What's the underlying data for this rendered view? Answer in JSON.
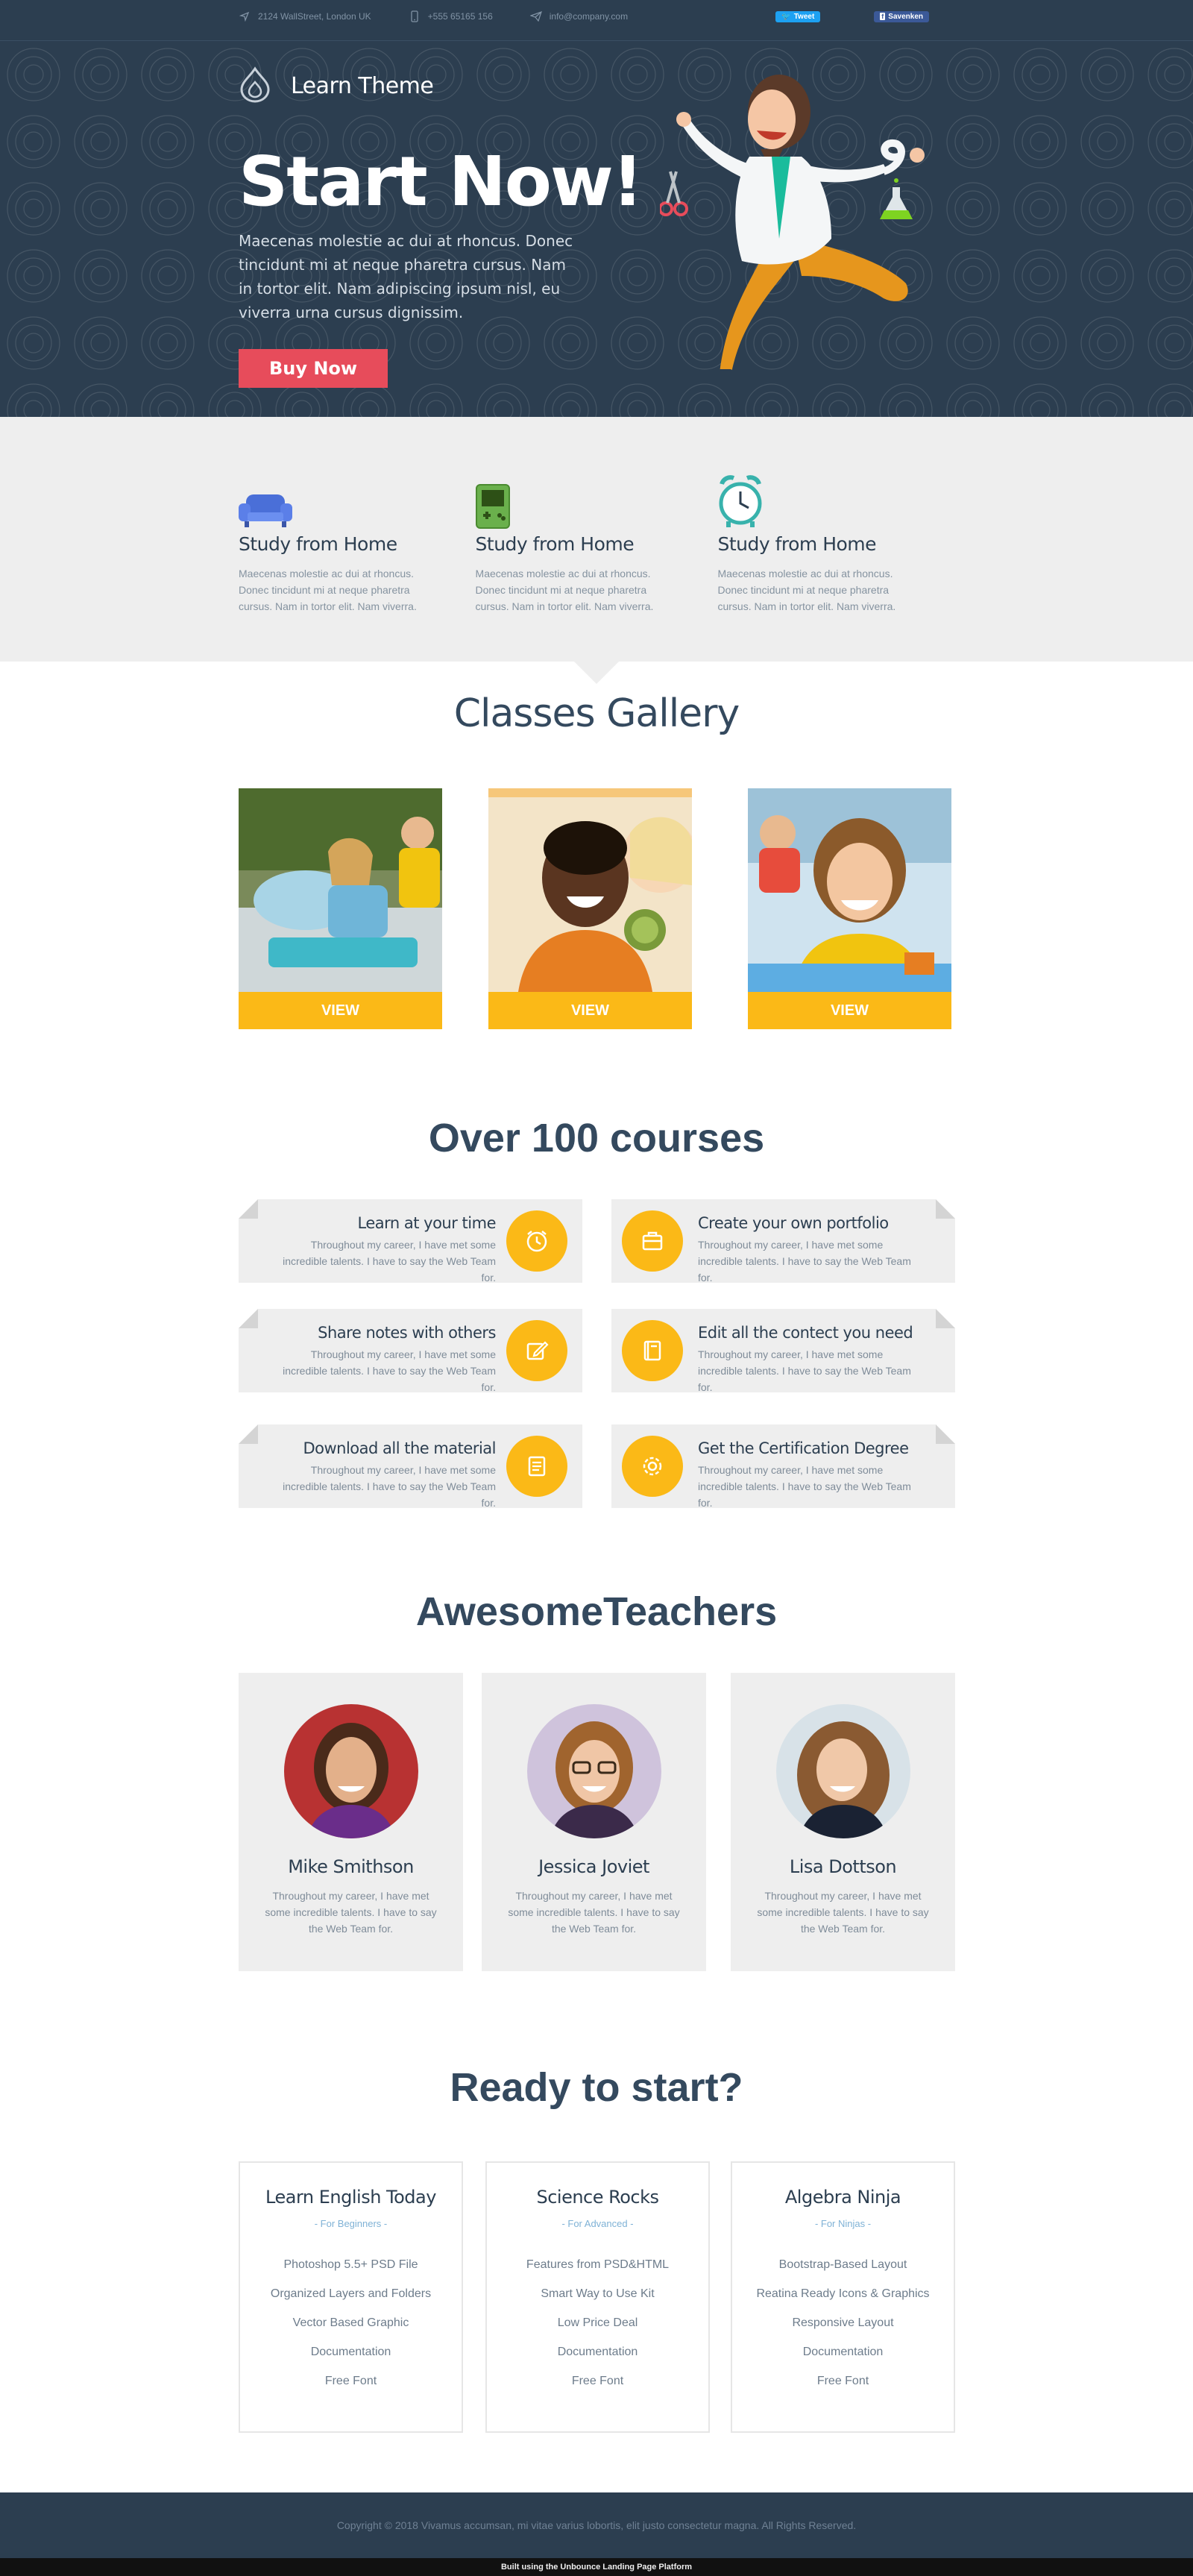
{
  "topbar": {
    "address": "2124 WallStreet, London UK",
    "phone": "+555 65165 156",
    "email": "info@company.com",
    "tweet_label": "Tweet",
    "share_label": "Savenken"
  },
  "hero": {
    "logo_text": "Learn Theme",
    "title": "Start Now!",
    "description": "Maecenas molestie ac dui at rhoncus. Donec tincidunt mi at neque pharetra cursus. Nam in tortor elit. Nam adipiscing ipsum nisl, eu viverra urna cursus dignissim.",
    "cta_label": "Buy Now"
  },
  "features": [
    {
      "icon": "armchair-icon",
      "title": "Study from Home",
      "text": "Maecenas molestie ac dui at rhoncus. Donec tincidunt mi at neque pharetra cursus. Nam in tortor elit. Nam viverra."
    },
    {
      "icon": "gameboy-icon",
      "title": "Study from Home",
      "text": "Maecenas molestie ac dui at rhoncus. Donec tincidunt mi at neque pharetra cursus. Nam in tortor elit. Nam viverra."
    },
    {
      "icon": "alarm-clock-icon",
      "title": "Study from Home",
      "text": "Maecenas molestie ac dui at rhoncus. Donec tincidunt mi at neque pharetra cursus. Nam in tortor elit. Nam viverra."
    }
  ],
  "gallery": {
    "title": "Classes Gallery",
    "items": [
      {
        "button": "VIEW"
      },
      {
        "button": "VIEW"
      },
      {
        "button": "VIEW"
      }
    ]
  },
  "courses": {
    "title": "Over 100 courses",
    "items": [
      {
        "title": "Learn at your time",
        "text": "Throughout my career, I have met some incredible talents. I have to say the Web Team for.",
        "icon": "clock-icon"
      },
      {
        "title": "Create your own portfolio",
        "text": "Throughout my career, I have met some incredible talents. I have to say the Web Team for.",
        "icon": "briefcase-icon"
      },
      {
        "title": "Share notes with others",
        "text": "Throughout my career, I have met some incredible talents. I have to say the Web Team for.",
        "icon": "edit-icon"
      },
      {
        "title": "Edit all the contect you need",
        "text": "Throughout my career, I have met some incredible talents. I have to say the Web Team for.",
        "icon": "book-icon"
      },
      {
        "title": "Download all the material",
        "text": "Throughout my career, I have met some incredible talents. I have to say the Web Team for.",
        "icon": "document-icon"
      },
      {
        "title": "Get the Certification Degree",
        "text": "Throughout my career, I have met some incredible talents. I have to say the Web Team for.",
        "icon": "gear-icon"
      }
    ]
  },
  "teachers": {
    "title": "AwesomeTeachers",
    "items": [
      {
        "name": "Mike Smithson",
        "text": "Throughout my career, I have met some incredible talents. I have to say the Web Team for."
      },
      {
        "name": "Jessica Joviet",
        "text": "Throughout my career, I have met some incredible talents. I have to say the Web Team for."
      },
      {
        "name": "Lisa Dottson",
        "text": "Throughout my career, I have met some incredible talents. I have to say the Web Team for."
      }
    ]
  },
  "plans": {
    "title": "Ready to start?",
    "items": [
      {
        "title": "Learn English Today",
        "subtitle": "- For Beginners -",
        "features": [
          "Photoshop 5.5+ PSD File",
          "Organized Layers and Folders",
          "Vector Based Graphic",
          "Documentation",
          "Free Font"
        ]
      },
      {
        "title": "Science Rocks",
        "subtitle": "- For Advanced -",
        "features": [
          "Features from PSD&HTML",
          "Smart Way to Use Kit",
          "Low Price Deal",
          "Documentation",
          "Free Font"
        ]
      },
      {
        "title": "Algebra Ninja",
        "subtitle": "- For Ninjas -",
        "features": [
          "Bootstrap-Based Layout",
          "Reatina Ready Icons & Graphics",
          "Responsive Layout",
          "Documentation",
          "Free Font"
        ]
      }
    ]
  },
  "footer": {
    "copyright": "Copyright © 2018 Vivamus accumsan, mi vitae varius lobortis, elit justo consectetur magna. All Rights Reserved.",
    "built": "Built using the Unbounce Landing Page Platform"
  },
  "colors": {
    "navy": "#2c3e50",
    "accent_yellow": "#fbb917",
    "cta_red": "#e74c5b",
    "light_gray": "#eeeeee"
  }
}
